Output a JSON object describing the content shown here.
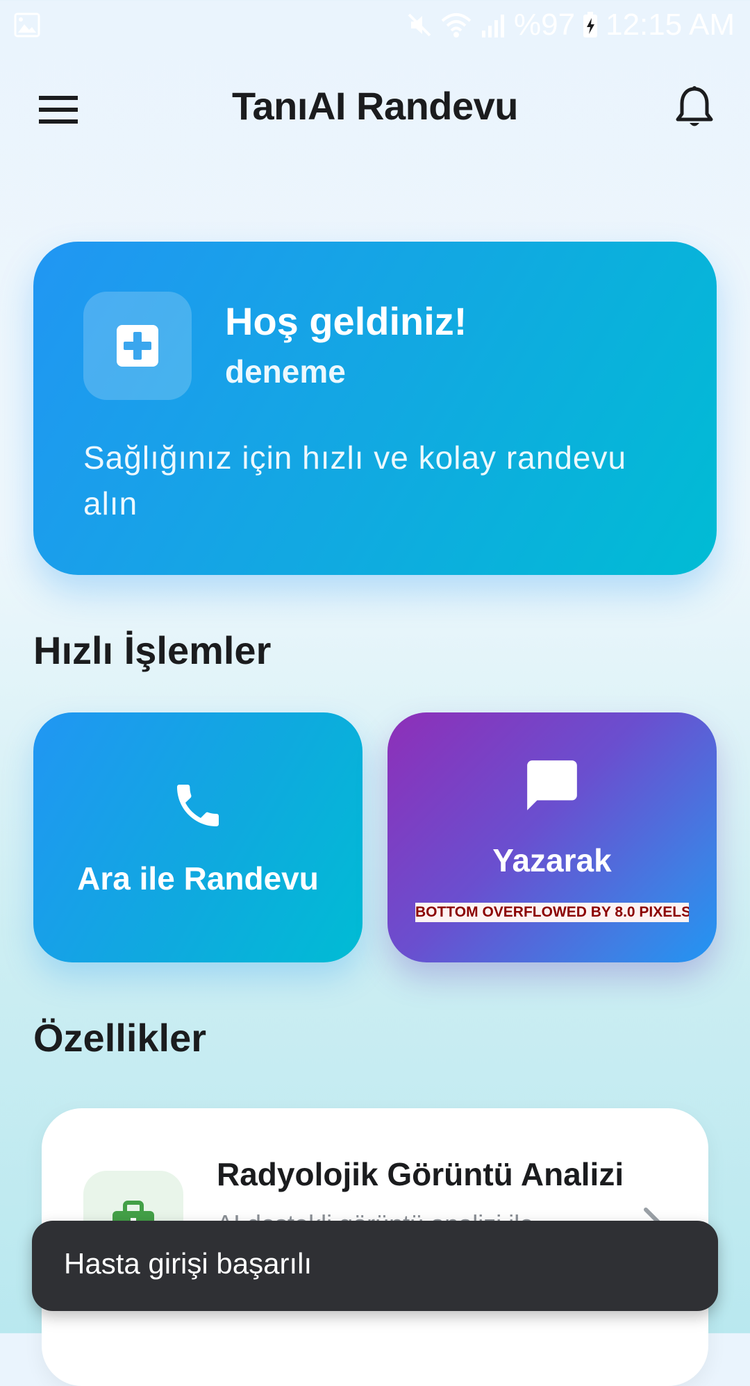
{
  "status_bar": {
    "battery": "%97",
    "time": "12:15 AM",
    "icons": [
      "gallery-icon",
      "mute-icon",
      "wifi-icon",
      "signal-icon",
      "battery-charging-icon"
    ]
  },
  "app_bar": {
    "title": "TanıAI Randevu",
    "icons": [
      "menu-icon",
      "bell-icon"
    ]
  },
  "welcome": {
    "title": "Hoş geldiniz!",
    "user": "deneme",
    "description": "Sağlığınız için hızlı ve kolay randevu alın",
    "icon": "medical-cross-icon"
  },
  "quick_actions": {
    "title": "Hızlı İşlemler",
    "items": [
      {
        "label": "Ara ile Randevu",
        "icon": "phone-icon"
      },
      {
        "label": "Yazarak Randevu",
        "icon": "chat-icon",
        "label_visible": "Yazarak"
      }
    ],
    "overflow_warning": "BOTTOM OVERFLOWED BY 8.0 PIXELS"
  },
  "features": {
    "title": "Özellikler",
    "items": [
      {
        "title": "Radyolojik Görüntü Analizi",
        "subtitle": "AI destekli görüntü analizi ile",
        "icon": "medical-kit-icon"
      }
    ]
  },
  "snackbar": {
    "message": "Hasta girişi başarılı"
  },
  "colors": {
    "primary_blue": "#2196f3",
    "cyan": "#00bcd4",
    "purple": "#8e2fb8",
    "snackbar_bg": "#2f3034",
    "overflow_text": "#8b0000"
  }
}
